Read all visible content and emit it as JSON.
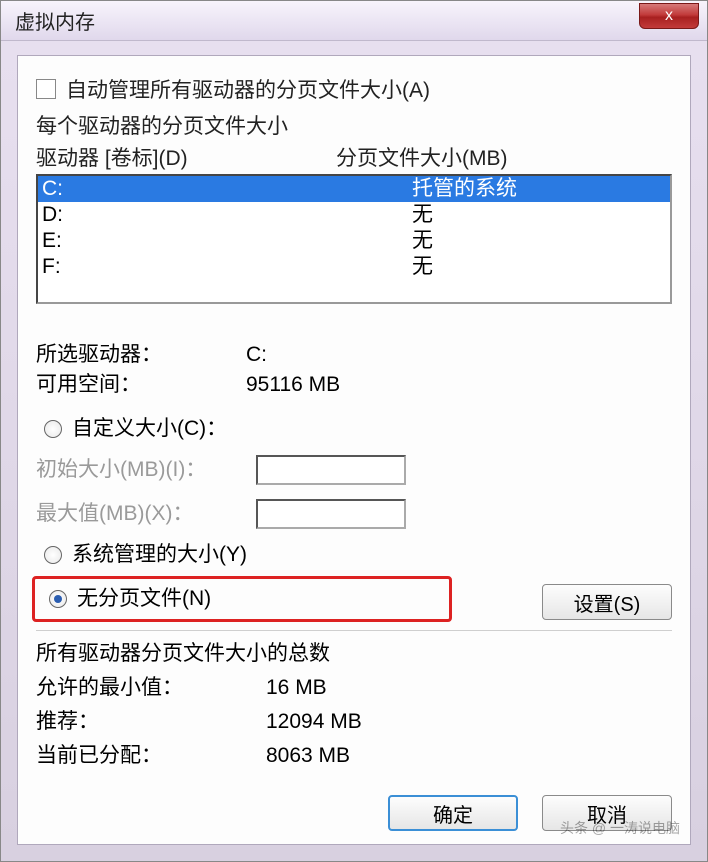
{
  "window": {
    "title": "虚拟内存",
    "close_icon": "x"
  },
  "auto_manage": {
    "label": "自动管理所有驱动器的分页文件大小(A)",
    "checked": false
  },
  "per_drive_title": "每个驱动器的分页文件大小",
  "columns": {
    "drive": "驱动器 [卷标](D)",
    "size": "分页文件大小(MB)"
  },
  "drives": [
    {
      "letter": "C:",
      "status": "托管的系统",
      "selected": true
    },
    {
      "letter": "D:",
      "status": "无",
      "selected": false
    },
    {
      "letter": "E:",
      "status": "无",
      "selected": false
    },
    {
      "letter": "F:",
      "status": "无",
      "selected": false
    }
  ],
  "selected_info": {
    "drive_label": "所选驱动器：",
    "drive_value": "C:",
    "free_label": "可用空间：",
    "free_value": "95116 MB"
  },
  "options": {
    "custom": {
      "label": "自定义大小(C)：",
      "checked": false
    },
    "initial_label": "初始大小(MB)(I)：",
    "max_label": "最大值(MB)(X)：",
    "system": {
      "label": "系统管理的大小(Y)",
      "checked": false
    },
    "none": {
      "label": "无分页文件(N)",
      "checked": true
    }
  },
  "set_button": "设置(S)",
  "totals_title": "所有驱动器分页文件大小的总数",
  "totals": {
    "min_label": "允许的最小值：",
    "min_value": "16 MB",
    "rec_label": "推荐：",
    "rec_value": "12094 MB",
    "cur_label": "当前已分配：",
    "cur_value": "8063 MB"
  },
  "buttons": {
    "ok": "确定",
    "cancel": "取消"
  },
  "watermark": "头条 @ 一涛说电脑"
}
